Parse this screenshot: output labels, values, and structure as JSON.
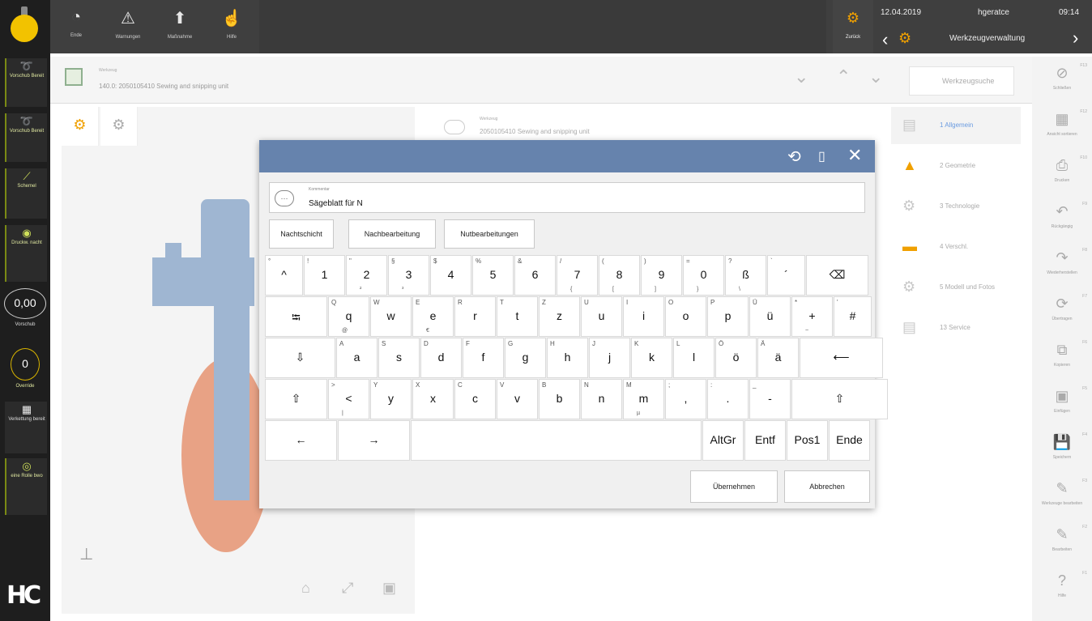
{
  "left_sidebar": {
    "buttons": [
      {
        "label": "Vorschub Bereit",
        "icon": "feed-icon"
      },
      {
        "label": "Vorschub Bereit",
        "icon": "feed-icon"
      },
      {
        "label": "Schemel",
        "icon": "tool-icon"
      },
      {
        "label": "Druckw. nacht",
        "icon": "coolant-icon"
      },
      {
        "label": "Verkettung bereit",
        "icon": "chain-icon"
      },
      {
        "label": "eine Rolle bwo",
        "icon": "reel-icon"
      }
    ],
    "feed_value": "0,00",
    "feed_label": "Vorschub",
    "spindle_value": "0",
    "spindle_label": "Override",
    "logo": "HC"
  },
  "top_bar": {
    "tools": [
      {
        "label": "Ende",
        "icon": "gauge-icon"
      },
      {
        "label": "Warnungen",
        "icon": "warning-icon"
      },
      {
        "label": "Maßnahme",
        "icon": "arrow-up-icon"
      },
      {
        "label": "Hilfe",
        "icon": "hand-icon"
      }
    ],
    "back_label": "Zurück",
    "date": "12.04.2019",
    "user": "hgeratce",
    "time": "09:14",
    "title": "Werkzeugverwaltung"
  },
  "path_bar": {
    "caption": "Werkzeug",
    "path": "140.0: 2050105410 Sewing and snipping unit",
    "search_label": "Werkzeugsuche"
  },
  "detail": {
    "caption": "Werkzeug",
    "name": "2050105410 Sewing and snipping unit"
  },
  "right_tabs": [
    {
      "label": "1 Allgemein",
      "icon": "list-icon"
    },
    {
      "label": "2 Geometrie",
      "icon": "geometry-icon"
    },
    {
      "label": "3 Technologie",
      "icon": "tech-icon"
    },
    {
      "label": "4 Verschl.",
      "icon": "wear-icon"
    },
    {
      "label": "5 Modell und Fotos",
      "icon": "model-icon"
    },
    {
      "label": "13 Service",
      "icon": "service-icon"
    }
  ],
  "right_sidebar": [
    {
      "label": "Schließen",
      "fkey": "F13",
      "icon": "close-circle-icon"
    },
    {
      "label": "Ansicht sortieren",
      "fkey": "F12",
      "icon": "table-icon"
    },
    {
      "label": "Drucken",
      "fkey": "F10",
      "icon": "print-icon"
    },
    {
      "label": "Rückgängig",
      "fkey": "F9",
      "icon": "undo-icon"
    },
    {
      "label": "Wiederherstellen",
      "fkey": "F8",
      "icon": "redo-icon"
    },
    {
      "label": "Übertragen",
      "fkey": "F7",
      "icon": "transfer-icon"
    },
    {
      "label": "Kopieren",
      "fkey": "F6",
      "icon": "copy-icon"
    },
    {
      "label": "Einfügen",
      "fkey": "F5",
      "icon": "paste-icon"
    },
    {
      "label": "Speichern",
      "fkey": "F4",
      "icon": "save-icon"
    },
    {
      "label": "Werkzeuge bearbeiten",
      "fkey": "F3",
      "icon": "edit-tool-icon"
    },
    {
      "label": "Bearbeiten",
      "fkey": "F2",
      "icon": "pencil-icon"
    },
    {
      "label": "Hilfe",
      "fkey": "F1",
      "icon": "help-icon"
    }
  ],
  "dialog": {
    "field_caption": "Kommentar",
    "field_value": "Sägeblatt für N",
    "chips": [
      "Nachtschicht",
      "Nachbearbeitung",
      "Nutbearbeitungen"
    ],
    "keys_row1": [
      {
        "m": "^",
        "s": "°"
      },
      {
        "m": "1",
        "s": "!"
      },
      {
        "m": "2",
        "s": "\"",
        "a": "²"
      },
      {
        "m": "3",
        "s": "§",
        "a": "³"
      },
      {
        "m": "4",
        "s": "$"
      },
      {
        "m": "5",
        "s": "%"
      },
      {
        "m": "6",
        "s": "&"
      },
      {
        "m": "7",
        "s": "/",
        "a": "{"
      },
      {
        "m": "8",
        "s": "(",
        "a": "["
      },
      {
        "m": "9",
        "s": ")",
        "a": "]"
      },
      {
        "m": "0",
        "s": "=",
        "a": "}"
      },
      {
        "m": "ß",
        "s": "?",
        "a": "\\"
      },
      {
        "m": "´",
        "s": "`"
      },
      {
        "m": "⌫",
        "s": ""
      }
    ],
    "keys_row2": [
      {
        "m": "⭾",
        "s": ""
      },
      {
        "m": "q",
        "s": "Q",
        "a": "@"
      },
      {
        "m": "w",
        "s": "W"
      },
      {
        "m": "e",
        "s": "E",
        "a": "€"
      },
      {
        "m": "r",
        "s": "R"
      },
      {
        "m": "t",
        "s": "T"
      },
      {
        "m": "z",
        "s": "Z"
      },
      {
        "m": "u",
        "s": "U"
      },
      {
        "m": "i",
        "s": "I"
      },
      {
        "m": "o",
        "s": "O"
      },
      {
        "m": "p",
        "s": "P"
      },
      {
        "m": "ü",
        "s": "Ü"
      },
      {
        "m": "+",
        "s": "*",
        "a": "~"
      },
      {
        "m": "#",
        "s": "'"
      }
    ],
    "keys_row3": [
      {
        "m": "⇩",
        "s": ""
      },
      {
        "m": "a",
        "s": "A"
      },
      {
        "m": "s",
        "s": "S"
      },
      {
        "m": "d",
        "s": "D"
      },
      {
        "m": "f",
        "s": "F"
      },
      {
        "m": "g",
        "s": "G"
      },
      {
        "m": "h",
        "s": "H"
      },
      {
        "m": "j",
        "s": "J"
      },
      {
        "m": "k",
        "s": "K"
      },
      {
        "m": "l",
        "s": "L"
      },
      {
        "m": "ö",
        "s": "Ö"
      },
      {
        "m": "ä",
        "s": "Ä"
      },
      {
        "m": "⟵",
        "s": ""
      }
    ],
    "keys_row4": [
      {
        "m": "⇧",
        "s": ""
      },
      {
        "m": "<",
        "s": ">",
        "a": "|"
      },
      {
        "m": "y",
        "s": "Y"
      },
      {
        "m": "x",
        "s": "X"
      },
      {
        "m": "c",
        "s": "C"
      },
      {
        "m": "v",
        "s": "V"
      },
      {
        "m": "b",
        "s": "B"
      },
      {
        "m": "n",
        "s": "N"
      },
      {
        "m": "m",
        "s": "M",
        "a": "µ"
      },
      {
        "m": ",",
        "s": ";"
      },
      {
        "m": ".",
        "s": ":"
      },
      {
        "m": "-",
        "s": "_"
      },
      {
        "m": "⇧",
        "s": ""
      }
    ],
    "keys_row5": [
      {
        "m": "←"
      },
      {
        "m": "→"
      },
      {
        "m": ""
      },
      {
        "m": "AltGr"
      },
      {
        "m": "Entf"
      },
      {
        "m": "Pos1"
      },
      {
        "m": "Ende"
      }
    ],
    "ok_label": "Übernehmen",
    "cancel_label": "Abbrechen"
  },
  "colors": {
    "dialog_header": "#6683ad",
    "accent_yellow": "#f2c200",
    "model_blue": "#9fb6d2",
    "model_orange": "#e8a285"
  }
}
